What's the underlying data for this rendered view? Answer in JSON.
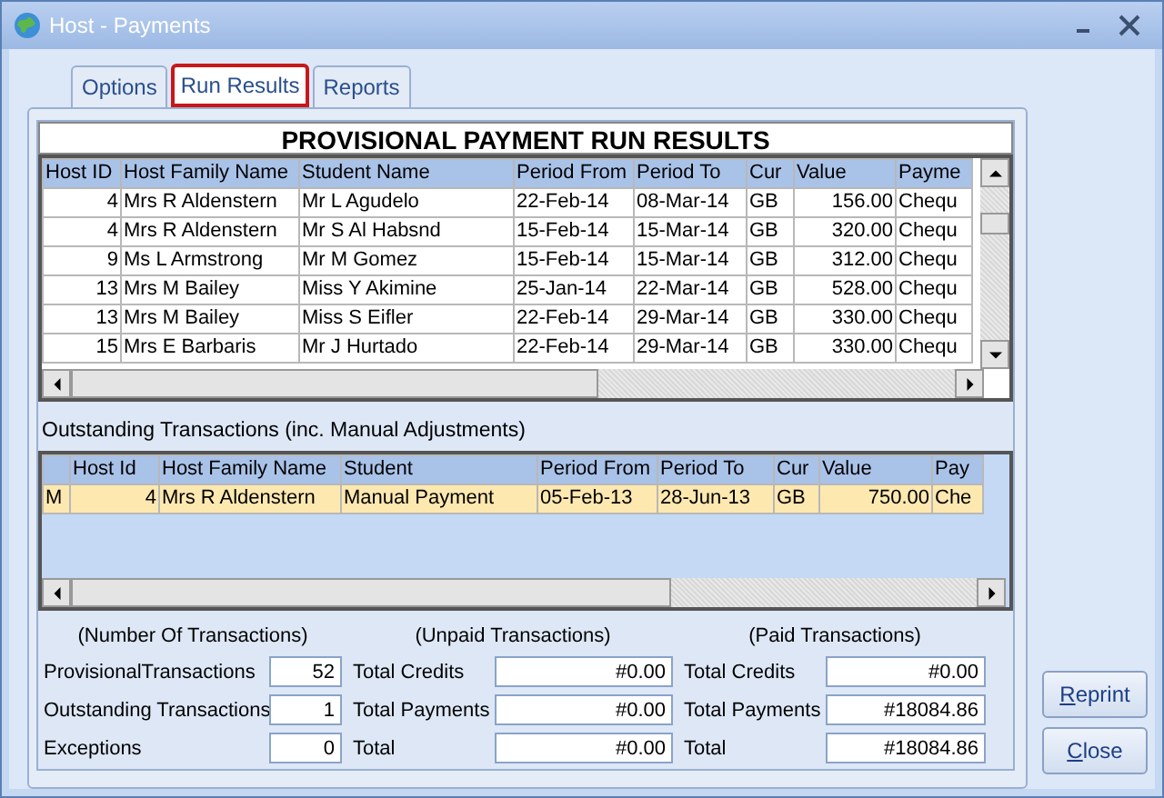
{
  "window": {
    "title": "Host - Payments"
  },
  "tabs": [
    {
      "label": "Options",
      "selected": false
    },
    {
      "label": "Run Results",
      "selected": true
    },
    {
      "label": "Reports",
      "selected": false
    }
  ],
  "heading": "PROVISIONAL PAYMENT RUN RESULTS",
  "results_table": {
    "columns": [
      "Host ID",
      "Host Family Name",
      "Student Name",
      "Period From",
      "Period To",
      "Cur",
      "Value",
      "Payme"
    ],
    "rows": [
      [
        "4",
        "Mrs R Aldenstern",
        "Mr L Agudelo",
        "22-Feb-14",
        "08-Mar-14",
        "GB",
        "156.00",
        "Chequ"
      ],
      [
        "4",
        "Mrs R Aldenstern",
        "Mr S Al Habsnd",
        "15-Feb-14",
        "15-Mar-14",
        "GB",
        "320.00",
        "Chequ"
      ],
      [
        "9",
        "Ms L Armstrong",
        "Mr M Gomez",
        "15-Feb-14",
        "15-Mar-14",
        "GB",
        "312.00",
        "Chequ"
      ],
      [
        "13",
        "Mrs M Bailey",
        "Miss Y Akimine",
        "25-Jan-14",
        "22-Mar-14",
        "GB",
        "528.00",
        "Chequ"
      ],
      [
        "13",
        "Mrs M Bailey",
        "Miss S Eifler",
        "22-Feb-14",
        "29-Mar-14",
        "GB",
        "330.00",
        "Chequ"
      ],
      [
        "15",
        "Mrs E Barbaris",
        "Mr J Hurtado",
        "22-Feb-14",
        "29-Mar-14",
        "GB",
        "330.00",
        "Chequ"
      ]
    ]
  },
  "outstanding_label": "Outstanding Transactions (inc. Manual Adjustments)",
  "outstanding_table": {
    "columns": [
      "Host Id",
      "Host Family Name",
      "Student",
      "Period From",
      "Period To",
      "Cur",
      "Value",
      "Pay"
    ],
    "rows": [
      {
        "marker": "M",
        "selected": true,
        "cells": [
          "4",
          "Mrs R Aldenstern",
          "Manual Payment",
          "05-Feb-13",
          "28-Jun-13",
          "GB",
          "750.00",
          "Che"
        ]
      }
    ]
  },
  "summary": [
    {
      "heading": "(Number Of Transactions)",
      "rows": [
        {
          "label": "ProvisionalTransactions",
          "value": "52"
        },
        {
          "label": "Outstanding Transactions",
          "value": "1"
        },
        {
          "label": "Exceptions",
          "value": "0"
        }
      ]
    },
    {
      "heading": "(Unpaid Transactions)",
      "rows": [
        {
          "label": "Total Credits",
          "value": "#0.00"
        },
        {
          "label": "Total Payments",
          "value": "#0.00"
        },
        {
          "label": "Total",
          "value": "#0.00"
        }
      ]
    },
    {
      "heading": "(Paid Transactions)",
      "rows": [
        {
          "label": "Total Credits",
          "value": "#0.00"
        },
        {
          "label": "Total Payments",
          "value": "#18084.86"
        },
        {
          "label": "Total",
          "value": "#18084.86"
        }
      ]
    }
  ],
  "buttons": [
    {
      "label": "Reprint",
      "underline_first": true
    },
    {
      "label": "Close",
      "underline_first": true
    }
  ]
}
